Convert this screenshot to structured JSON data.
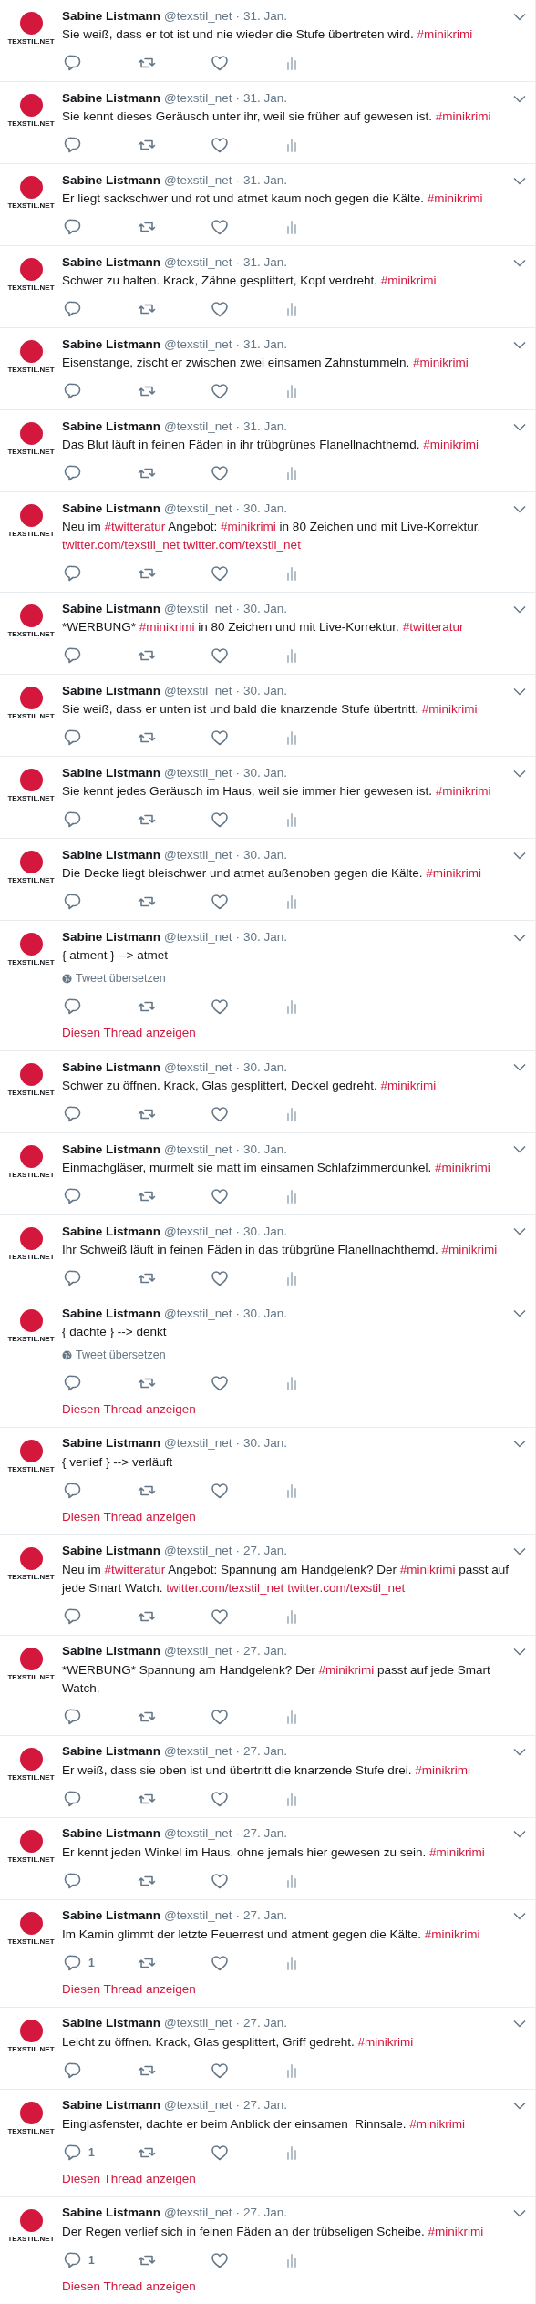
{
  "tweets": [
    {
      "avatar_label": "TEXSTIL.NET",
      "author": "Sabine Listmann",
      "handle": "@texstil_net",
      "separator": "·",
      "date": "31. Jan.",
      "parts": [
        {
          "kind": "text",
          "text": "Sie weiß, dass er tot ist und nie wieder die Stufe übertreten wird. "
        },
        {
          "kind": "tag",
          "text": "#minikrimi"
        }
      ]
    },
    {
      "avatar_label": "TEXSTIL.NET",
      "author": "Sabine Listmann",
      "handle": "@texstil_net",
      "separator": "·",
      "date": "31. Jan.",
      "parts": [
        {
          "kind": "text",
          "text": "Sie kennt dieses Geräusch unter ihr, weil sie früher auf gewesen ist. "
        },
        {
          "kind": "tag",
          "text": "#minikrimi"
        }
      ]
    },
    {
      "avatar_label": "TEXSTIL.NET",
      "author": "Sabine Listmann",
      "handle": "@texstil_net",
      "separator": "·",
      "date": "31. Jan.",
      "parts": [
        {
          "kind": "text",
          "text": "Er liegt sackschwer und rot und atmet kaum noch gegen die Kälte. "
        },
        {
          "kind": "tag",
          "text": "#minikrimi"
        }
      ]
    },
    {
      "avatar_label": "TEXSTIL.NET",
      "author": "Sabine Listmann",
      "handle": "@texstil_net",
      "separator": "·",
      "date": "31. Jan.",
      "parts": [
        {
          "kind": "text",
          "text": "Schwer zu halten. Krack, Zähne gesplittert, Kopf verdreht. "
        },
        {
          "kind": "tag",
          "text": "#minikrimi"
        }
      ]
    },
    {
      "avatar_label": "TEXSTIL.NET",
      "author": "Sabine Listmann",
      "handle": "@texstil_net",
      "separator": "·",
      "date": "31. Jan.",
      "parts": [
        {
          "kind": "text",
          "text": "Eisenstange, zischt er zwischen zwei einsamen Zahnstummeln. "
        },
        {
          "kind": "tag",
          "text": "#minikrimi"
        }
      ]
    },
    {
      "avatar_label": "TEXSTIL.NET",
      "author": "Sabine Listmann",
      "handle": "@texstil_net",
      "separator": "·",
      "date": "31. Jan.",
      "parts": [
        {
          "kind": "text",
          "text": "Das Blut läuft in feinen Fäden in ihr trübgrünes Flanellnachthemd. "
        },
        {
          "kind": "tag",
          "text": "#minikrimi"
        }
      ]
    },
    {
      "avatar_label": "TEXSTIL.NET",
      "author": "Sabine Listmann",
      "handle": "@texstil_net",
      "separator": "·",
      "date": "30. Jan.",
      "parts": [
        {
          "kind": "text",
          "text": "Neu im "
        },
        {
          "kind": "tag",
          "text": "#twitteratur"
        },
        {
          "kind": "text",
          "text": " Angebot: "
        },
        {
          "kind": "tag",
          "text": "#minikrimi"
        },
        {
          "kind": "text",
          "text": " in 80 Zeichen und mit Live-Korrektur. "
        },
        {
          "kind": "link",
          "text": "twitter.com/texstil_net"
        },
        {
          "kind": "link",
          "text": "twitter.com/texstil_net"
        }
      ]
    },
    {
      "avatar_label": "TEXSTIL.NET",
      "author": "Sabine Listmann",
      "handle": "@texstil_net",
      "separator": "·",
      "date": "30. Jan.",
      "parts": [
        {
          "kind": "text",
          "text": "*WERBUNG* "
        },
        {
          "kind": "tag",
          "text": "#minikrimi"
        },
        {
          "kind": "text",
          "text": " in 80 Zeichen und mit Live-Korrektur. "
        },
        {
          "kind": "tag",
          "text": "#twitteratur"
        }
      ]
    },
    {
      "avatar_label": "TEXSTIL.NET",
      "author": "Sabine Listmann",
      "handle": "@texstil_net",
      "separator": "·",
      "date": "30. Jan.",
      "parts": [
        {
          "kind": "text",
          "text": "Sie weiß, dass er unten ist und bald die knarzende Stufe übertritt. "
        },
        {
          "kind": "tag",
          "text": "#minikrimi"
        }
      ]
    },
    {
      "avatar_label": "TEXSTIL.NET",
      "author": "Sabine Listmann",
      "handle": "@texstil_net",
      "separator": "·",
      "date": "30. Jan.",
      "parts": [
        {
          "kind": "text",
          "text": "Sie kennt jedes Geräusch im Haus, weil sie immer hier gewesen ist. "
        },
        {
          "kind": "tag",
          "text": "#minikrimi"
        }
      ]
    },
    {
      "avatar_label": "TEXSTIL.NET",
      "author": "Sabine Listmann",
      "handle": "@texstil_net",
      "separator": "·",
      "date": "30. Jan.",
      "parts": [
        {
          "kind": "text",
          "text": "Die Decke liegt bleischwer und atmet außenoben gegen die Kälte. "
        },
        {
          "kind": "tag",
          "text": "#minikrimi"
        }
      ]
    },
    {
      "avatar_label": "TEXSTIL.NET",
      "author": "Sabine Listmann",
      "handle": "@texstil_net",
      "separator": "·",
      "date": "30. Jan.",
      "parts": [
        {
          "kind": "text",
          "text": "{ atment } --> atmet"
        }
      ],
      "translate": "Tweet übersetzen",
      "thread_link": "Diesen Thread anzeigen"
    },
    {
      "avatar_label": "TEXSTIL.NET",
      "author": "Sabine Listmann",
      "handle": "@texstil_net",
      "separator": "·",
      "date": "30. Jan.",
      "parts": [
        {
          "kind": "text",
          "text": "Schwer zu öffnen. Krack, Glas gesplittert, Deckel gedreht. "
        },
        {
          "kind": "tag",
          "text": "#minikrimi"
        }
      ]
    },
    {
      "avatar_label": "TEXSTIL.NET",
      "author": "Sabine Listmann",
      "handle": "@texstil_net",
      "separator": "·",
      "date": "30. Jan.",
      "parts": [
        {
          "kind": "text",
          "text": "Einmachgläser, murmelt sie matt im einsamen Schlafzimmerdunkel. "
        },
        {
          "kind": "tag",
          "text": "#minikrimi"
        }
      ]
    },
    {
      "avatar_label": "TEXSTIL.NET",
      "author": "Sabine Listmann",
      "handle": "@texstil_net",
      "separator": "·",
      "date": "30. Jan.",
      "parts": [
        {
          "kind": "text",
          "text": "Ihr Schweiß läuft in feinen Fäden in das trübgrüne Flanellnachthemd. "
        },
        {
          "kind": "tag",
          "text": "#minikrimi"
        }
      ]
    },
    {
      "avatar_label": "TEXSTIL.NET",
      "author": "Sabine Listmann",
      "handle": "@texstil_net",
      "separator": "·",
      "date": "30. Jan.",
      "parts": [
        {
          "kind": "text",
          "text": "{ dachte } --> denkt"
        }
      ],
      "translate": "Tweet übersetzen",
      "thread_link": "Diesen Thread anzeigen"
    },
    {
      "avatar_label": "TEXSTIL.NET",
      "author": "Sabine Listmann",
      "handle": "@texstil_net",
      "separator": "·",
      "date": "30. Jan.",
      "parts": [
        {
          "kind": "text",
          "text": "{ verlief } --> verläuft"
        }
      ],
      "thread_link": "Diesen Thread anzeigen"
    },
    {
      "avatar_label": "TEXSTIL.NET",
      "author": "Sabine Listmann",
      "handle": "@texstil_net",
      "separator": "·",
      "date": "27. Jan.",
      "parts": [
        {
          "kind": "text",
          "text": "Neu im "
        },
        {
          "kind": "tag",
          "text": "#twitteratur"
        },
        {
          "kind": "text",
          "text": " Angebot: Spannung am Handgelenk? Der "
        },
        {
          "kind": "tag",
          "text": "#minikrimi"
        },
        {
          "kind": "text",
          "text": " passt auf jede Smart Watch. "
        },
        {
          "kind": "link",
          "text": "twitter.com/texstil_net"
        },
        {
          "kind": "link",
          "text": "twitter.com/texstil_net"
        }
      ]
    },
    {
      "avatar_label": "TEXSTIL.NET",
      "author": "Sabine Listmann",
      "handle": "@texstil_net",
      "separator": "·",
      "date": "27. Jan.",
      "parts": [
        {
          "kind": "text",
          "text": "*WERBUNG* Spannung am Handgelenk? Der "
        },
        {
          "kind": "tag",
          "text": "#minikrimi"
        },
        {
          "kind": "text",
          "text": " passt auf jede Smart Watch."
        }
      ]
    },
    {
      "avatar_label": "TEXSTIL.NET",
      "author": "Sabine Listmann",
      "handle": "@texstil_net",
      "separator": "·",
      "date": "27. Jan.",
      "parts": [
        {
          "kind": "text",
          "text": "Er weiß, dass sie oben ist und übertritt die knarzende Stufe drei. "
        },
        {
          "kind": "tag",
          "text": "#minikrimi"
        }
      ]
    },
    {
      "avatar_label": "TEXSTIL.NET",
      "author": "Sabine Listmann",
      "handle": "@texstil_net",
      "separator": "·",
      "date": "27. Jan.",
      "parts": [
        {
          "kind": "text",
          "text": "Er kennt jeden Winkel im Haus, ohne jemals hier gewesen zu sein. "
        },
        {
          "kind": "tag",
          "text": "#minikrimi"
        }
      ]
    },
    {
      "avatar_label": "TEXSTIL.NET",
      "author": "Sabine Listmann",
      "handle": "@texstil_net",
      "separator": "·",
      "date": "27. Jan.",
      "parts": [
        {
          "kind": "text",
          "text": "Im Kamin glimmt der letzte Feuerrest und atment gegen die Kälte. "
        },
        {
          "kind": "tag",
          "text": "#minikrimi"
        }
      ],
      "reply_count": "1",
      "thread_link": "Diesen Thread anzeigen"
    },
    {
      "avatar_label": "TEXSTIL.NET",
      "author": "Sabine Listmann",
      "handle": "@texstil_net",
      "separator": "·",
      "date": "27. Jan.",
      "parts": [
        {
          "kind": "text",
          "text": "Leicht zu öffnen. Krack, Glas gesplittert, Griff gedreht. "
        },
        {
          "kind": "tag",
          "text": "#minikrimi"
        }
      ]
    },
    {
      "avatar_label": "TEXSTIL.NET",
      "author": "Sabine Listmann",
      "handle": "@texstil_net",
      "separator": "·",
      "date": "27. Jan.",
      "parts": [
        {
          "kind": "text",
          "text": "Einglasfenster, dachte er beim Anblick der einsamen  Rinnsale. "
        },
        {
          "kind": "tag",
          "text": "#minikrimi"
        }
      ],
      "reply_count": "1",
      "thread_link": "Diesen Thread anzeigen"
    },
    {
      "avatar_label": "TEXSTIL.NET",
      "author": "Sabine Listmann",
      "handle": "@texstil_net",
      "separator": "·",
      "date": "27. Jan.",
      "parts": [
        {
          "kind": "text",
          "text": "Der Regen verlief sich in feinen Fäden an der trübseligen Scheibe. "
        },
        {
          "kind": "tag",
          "text": "#minikrimi"
        }
      ],
      "reply_count": "1",
      "thread_link": "Diesen Thread anzeigen"
    }
  ]
}
